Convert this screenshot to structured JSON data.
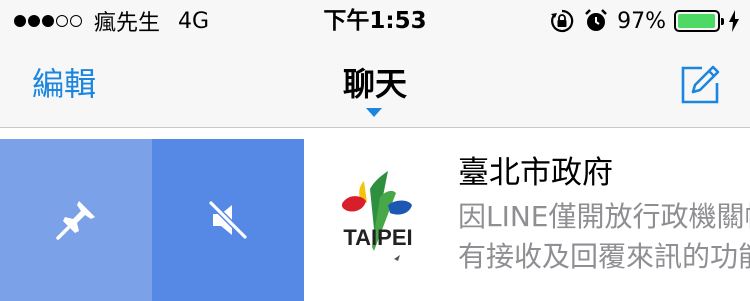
{
  "status_bar": {
    "carrier": "瘋先生",
    "network": "4G",
    "time": "下午1:53",
    "battery_percent": "97%",
    "battery_level": 0.97,
    "signal_bars_filled": 3,
    "signal_bars_total": 5,
    "battery_color": "#4cd964"
  },
  "nav": {
    "edit_label": "編輯",
    "title": "聊天",
    "accent_color": "#1a86e0",
    "compose_icon": "compose-icon"
  },
  "chat_row": {
    "pin_icon": "pin-icon",
    "mute_icon": "mute-icon",
    "pin_color": "#7ba1e8",
    "mute_color": "#5688e5",
    "name": "臺北市政府",
    "preview_line1": "因LINE僅開放行政機關帳",
    "preview_line2": "有接收及回覆來訊的功能",
    "avatar_text": "TAIPEI"
  }
}
